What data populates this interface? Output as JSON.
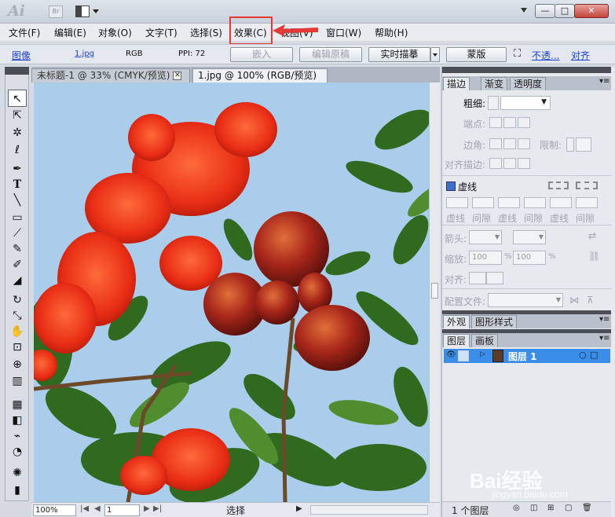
{
  "titlebar": {
    "logo": "Ai",
    "bridge_label": "Br",
    "min_label": "—",
    "max_label": "□",
    "close_label": "✕"
  },
  "menu": [
    {
      "label": "文件(F)"
    },
    {
      "label": "编辑(E)"
    },
    {
      "label": "对象(O)"
    },
    {
      "label": "文字(T)"
    },
    {
      "label": "选择(S)"
    },
    {
      "label": "效果(C)"
    },
    {
      "label": "视图(V)"
    },
    {
      "label": "窗口(W)"
    },
    {
      "label": "帮助(H)"
    }
  ],
  "controlbar": {
    "type_label": "图像",
    "file_link": "1.jpg",
    "color_mode": "RGB",
    "ppi": "PPI: 72",
    "embed_button": "嵌入",
    "edit_original_button": "编辑原稿",
    "live_trace_button": "实时描摹",
    "mask_button": "蒙版",
    "opacity_link": "不透...",
    "align_link": "对齐"
  },
  "tabs": [
    {
      "label": "未标题-1 @ 33% (CMYK/预览)"
    },
    {
      "label": "1.jpg @ 100% (RGB/预览)"
    }
  ],
  "statusbar": {
    "zoom": "100%",
    "page": "1",
    "tool_status": "选择"
  },
  "stroke_panel": {
    "tabs": [
      "描边",
      "渐变",
      "透明度"
    ],
    "weight_label": "粗细:",
    "cap_label": "端点:",
    "corner_label": "边角:",
    "limit_label": "限制:",
    "align_label": "对齐描边:",
    "dashed_label": "虚线",
    "dash_labels": [
      "虚线",
      "间隙",
      "虚线",
      "间隙",
      "虚线",
      "间隙"
    ],
    "arrow_label": "箭头:",
    "scale_label": "缩放:",
    "scale_value_1": "100",
    "scale_value_2": "100",
    "percent": "%",
    "align2_label": "对齐:",
    "profile_label": "配置文件:"
  },
  "appearance_panel": {
    "tabs": [
      "外观",
      "图形样式"
    ]
  },
  "layers_panel": {
    "tabs": [
      "图层",
      "画板"
    ],
    "layer_name": "图层 1",
    "footer": "1 个图层"
  },
  "watermark": {
    "brand": "Bai经验",
    "url": "jingyan.baidu.com"
  },
  "colors": {
    "highlight": "#e53935",
    "layer_selected": "#3b8ee8",
    "sky": "#a9cdea"
  }
}
